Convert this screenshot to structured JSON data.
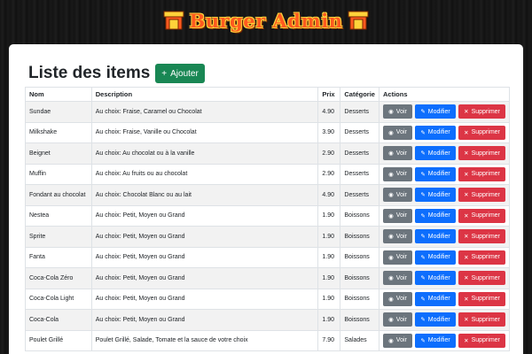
{
  "header": {
    "brand": "Burger Admin",
    "icon": "burger-shop-icon"
  },
  "page": {
    "title": "Liste des items",
    "add_label": "Ajouter",
    "add_icon": "plus-icon"
  },
  "colors": {
    "add": "#198754",
    "view": "#6c757d",
    "edit": "#0d6efd",
    "delete": "#dc3545",
    "brand": "#ff5a1f"
  },
  "table": {
    "headers": {
      "name": "Nom",
      "description": "Description",
      "price": "Prix",
      "category": "Catégorie",
      "actions": "Actions"
    },
    "actions": {
      "view": "Voir",
      "edit": "Modifier",
      "delete": "Supprimer",
      "view_icon": "eye-icon",
      "edit_icon": "pencil-icon",
      "delete_icon": "x-icon"
    },
    "rows": [
      {
        "name": "Sundae",
        "description": "Au choix: Fraise, Caramel ou Chocolat",
        "price": "4.90",
        "category": "Desserts"
      },
      {
        "name": "Milkshake",
        "description": "Au choix: Fraise, Vanille ou Chocolat",
        "price": "3.90",
        "category": "Desserts"
      },
      {
        "name": "Beignet",
        "description": "Au choix: Au chocolat ou à la vanille",
        "price": "2.90",
        "category": "Desserts"
      },
      {
        "name": "Muffin",
        "description": "Au choix: Au fruits ou au chocolat",
        "price": "2.90",
        "category": "Desserts"
      },
      {
        "name": "Fondant au chocolat",
        "description": "Au choix: Chocolat Blanc ou au lait",
        "price": "4.90",
        "category": "Desserts"
      },
      {
        "name": "Nestea",
        "description": "Au choix: Petit, Moyen ou Grand",
        "price": "1.90",
        "category": "Boissons"
      },
      {
        "name": "Sprite",
        "description": "Au choix: Petit, Moyen ou Grand",
        "price": "1.90",
        "category": "Boissons"
      },
      {
        "name": "Fanta",
        "description": "Au choix: Petit, Moyen ou Grand",
        "price": "1.90",
        "category": "Boissons"
      },
      {
        "name": "Coca-Cola Zéro",
        "description": "Au choix: Petit, Moyen ou Grand",
        "price": "1.90",
        "category": "Boissons"
      },
      {
        "name": "Coca-Cola Light",
        "description": "Au choix: Petit, Moyen ou Grand",
        "price": "1.90",
        "category": "Boissons"
      },
      {
        "name": "Coca-Cola",
        "description": "Au choix: Petit, Moyen ou Grand",
        "price": "1.90",
        "category": "Boissons"
      },
      {
        "name": "Poulet Grillé",
        "description": "Poulet Grillé, Salade, Tomate et la sauce de votre choix",
        "price": "7.90",
        "category": "Salades"
      }
    ]
  }
}
